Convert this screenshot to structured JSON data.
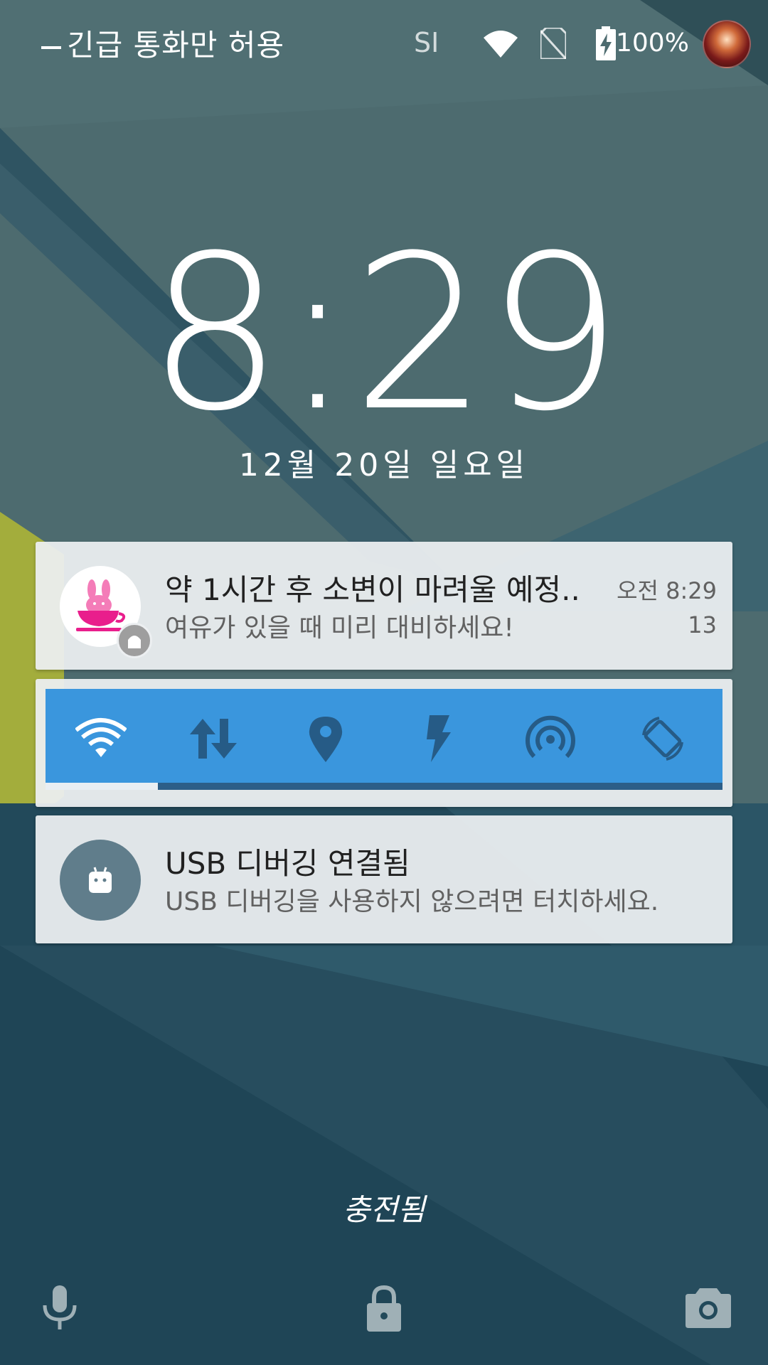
{
  "status_bar": {
    "carrier": "긴급 통화만 허용",
    "signal_text": "SI",
    "battery_percent": "100%",
    "icons": [
      "wifi-icon",
      "no-sim-icon",
      "battery-charging-icon"
    ]
  },
  "lockscreen": {
    "time": "8:29",
    "date": "12월 20일 일요일",
    "charging_status": "충전됨"
  },
  "notifications": [
    {
      "app_icon": "rabbit-teacup-icon",
      "title": "약 1시간 후 소변이 마려울 예정..",
      "text": "여유가 있을 때 미리 대비하세요!",
      "time": "오전 8:29",
      "count": "13"
    },
    {
      "app_icon": "android-debug-icon",
      "title": "USB 디버깅 연결됨",
      "text": "USB 디버깅을 사용하지 않으려면 터치하세요."
    }
  ],
  "quick_settings": {
    "tiles": [
      "wifi-toggle",
      "mobile-data-toggle",
      "location-toggle",
      "flashlight-toggle",
      "hotspot-toggle",
      "auto-rotate-toggle"
    ],
    "accent": "#3a96dd",
    "scroll_position_fraction": 0.17
  },
  "bottom_actions": [
    "voice-assist",
    "lock",
    "camera"
  ],
  "colors": {
    "background": "#4b6a6e",
    "card": "#eceff1",
    "app_accent": "#e91e8c"
  }
}
